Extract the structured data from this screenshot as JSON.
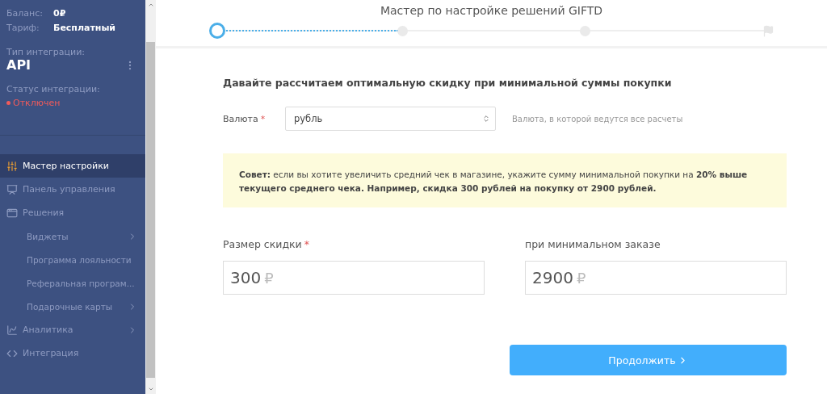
{
  "account": {
    "fields": [
      {
        "label": "Баланс:",
        "value": "0₽"
      },
      {
        "label": "Тариф:",
        "value": "Бесплатный"
      }
    ],
    "integration_type": {
      "label": "Тип интеграции:",
      "value": "API"
    },
    "integration_status": {
      "label": "Статус интеграции:",
      "value": "Отключен",
      "color": "#ef5b5b"
    }
  },
  "sidebar": {
    "items": [
      {
        "label": "Мастер настройки",
        "kind": "top",
        "selected": true,
        "has_children": false
      },
      {
        "label": "Панель управления",
        "kind": "top",
        "selected": false,
        "has_children": false
      },
      {
        "label": "Решения",
        "kind": "top",
        "selected": false,
        "has_children": false
      },
      {
        "label": "Виджеты",
        "kind": "sub",
        "selected": false,
        "has_children": true
      },
      {
        "label": "Программа лояльности",
        "kind": "sub",
        "selected": false,
        "has_children": false
      },
      {
        "label": "Реферальная програм...",
        "kind": "sub",
        "selected": false,
        "has_children": false
      },
      {
        "label": "Подарочные карты",
        "kind": "sub",
        "selected": false,
        "has_children": true
      },
      {
        "label": "Аналитика",
        "kind": "top",
        "selected": false,
        "has_children": true
      },
      {
        "label": "Интеграция",
        "kind": "top",
        "selected": false,
        "has_children": false
      }
    ]
  },
  "wizard": {
    "title": "Мастер по настройке решений GIFTD",
    "level": 0.33,
    "steps": [
      {
        "kind": "dot",
        "selected": true
      },
      {
        "kind": "dot",
        "selected": false
      },
      {
        "kind": "dot",
        "selected": false
      },
      {
        "kind": "flag",
        "selected": false
      }
    ]
  },
  "form": {
    "heading": "Давайте рассчитаем оптимальную скидку при минимальной суммы покупки",
    "currency": {
      "label": "Валюта",
      "required_mark": "*",
      "value": "рубль",
      "hint": "Валюта, в которой ведутся все расчеты"
    },
    "tip": "**Совет:** если вы хотите увеличить средний чек в магазине, укажите сумму минимальной покупки на **20% выше текущего среднего чека. Например, скидка 300 рублей на покупку от 2900 рублей.**",
    "amounts": [
      {
        "label": "Размер скидки",
        "required_mark": "*",
        "value": "300",
        "suffix": "₽"
      },
      {
        "label": "при минимальном заказе",
        "value": "2900",
        "suffix": "₽"
      }
    ],
    "submit": "Продолжить"
  }
}
